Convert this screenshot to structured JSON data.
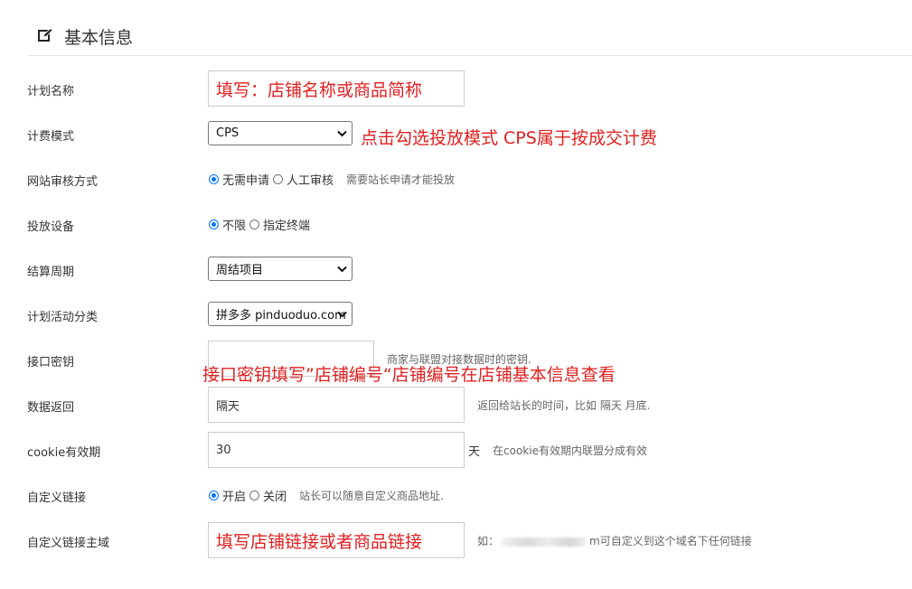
{
  "section": {
    "title": "基本信息",
    "icon": "edit-icon"
  },
  "fields": {
    "plan_name": {
      "label": "计划名称",
      "value": "填写：店铺名称或商品简称"
    },
    "billing_mode": {
      "label": "计费模式",
      "selected": "CPS",
      "annotation": "点击勾选投放模式 CPS属于按成交计费"
    },
    "site_review": {
      "label": "网站审核方式",
      "options": [
        {
          "label": "无需申请",
          "checked": true
        },
        {
          "label": "人工审核",
          "checked": false
        }
      ],
      "help": "需要站长申请才能投放"
    },
    "device": {
      "label": "投放设备",
      "options": [
        {
          "label": "不限",
          "checked": true
        },
        {
          "label": "指定终端",
          "checked": false
        }
      ]
    },
    "settlement": {
      "label": "结算周期",
      "selected": "周结项目"
    },
    "activity_category": {
      "label": "计划活动分类",
      "selected": "拼多多 pinduoduo.com"
    },
    "api_key": {
      "label": "接口密钥",
      "value": "",
      "hint": "商家与联盟对接数据时的密钥.",
      "annotation": "接口密钥填写”店铺编号“店铺编号在店铺基本信息查看"
    },
    "data_return": {
      "label": "数据返回",
      "value": "隔天",
      "hint": "返回给站长的时间，比如 隔天 月底."
    },
    "cookie_validity": {
      "label": "cookie有效期",
      "value": "30",
      "unit": "天",
      "hint": "在cookie有效期内联盟分成有效"
    },
    "custom_link": {
      "label": "自定义链接",
      "options": [
        {
          "label": "开启",
          "checked": true
        },
        {
          "label": "关闭",
          "checked": false
        }
      ],
      "help": "站长可以随意自定义商品地址."
    },
    "custom_link_domain": {
      "label": "自定义链接主域",
      "value": "填写店铺链接或者商品链接",
      "hint_prefix": "如：",
      "hint_suffix": "m可自定义到这个域名下任何链接"
    }
  },
  "colors": {
    "annotation": "#e02020",
    "radio_checked": "#0075ff",
    "divider": "#e5e5e5"
  }
}
